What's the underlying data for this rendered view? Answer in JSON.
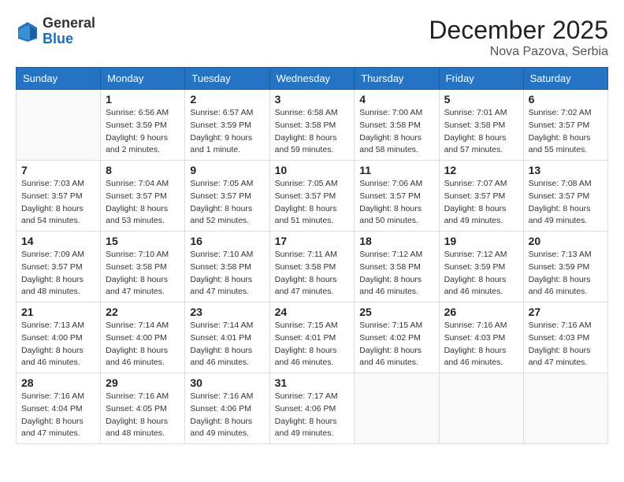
{
  "logo": {
    "general": "General",
    "blue": "Blue"
  },
  "header": {
    "month": "December 2025",
    "location": "Nova Pazova, Serbia"
  },
  "weekdays": [
    "Sunday",
    "Monday",
    "Tuesday",
    "Wednesday",
    "Thursday",
    "Friday",
    "Saturday"
  ],
  "weeks": [
    [
      {
        "day": "",
        "info": ""
      },
      {
        "day": "1",
        "info": "Sunrise: 6:56 AM\nSunset: 3:59 PM\nDaylight: 9 hours\nand 2 minutes."
      },
      {
        "day": "2",
        "info": "Sunrise: 6:57 AM\nSunset: 3:59 PM\nDaylight: 9 hours\nand 1 minute."
      },
      {
        "day": "3",
        "info": "Sunrise: 6:58 AM\nSunset: 3:58 PM\nDaylight: 8 hours\nand 59 minutes."
      },
      {
        "day": "4",
        "info": "Sunrise: 7:00 AM\nSunset: 3:58 PM\nDaylight: 8 hours\nand 58 minutes."
      },
      {
        "day": "5",
        "info": "Sunrise: 7:01 AM\nSunset: 3:58 PM\nDaylight: 8 hours\nand 57 minutes."
      },
      {
        "day": "6",
        "info": "Sunrise: 7:02 AM\nSunset: 3:57 PM\nDaylight: 8 hours\nand 55 minutes."
      }
    ],
    [
      {
        "day": "7",
        "info": "Sunrise: 7:03 AM\nSunset: 3:57 PM\nDaylight: 8 hours\nand 54 minutes."
      },
      {
        "day": "8",
        "info": "Sunrise: 7:04 AM\nSunset: 3:57 PM\nDaylight: 8 hours\nand 53 minutes."
      },
      {
        "day": "9",
        "info": "Sunrise: 7:05 AM\nSunset: 3:57 PM\nDaylight: 8 hours\nand 52 minutes."
      },
      {
        "day": "10",
        "info": "Sunrise: 7:05 AM\nSunset: 3:57 PM\nDaylight: 8 hours\nand 51 minutes."
      },
      {
        "day": "11",
        "info": "Sunrise: 7:06 AM\nSunset: 3:57 PM\nDaylight: 8 hours\nand 50 minutes."
      },
      {
        "day": "12",
        "info": "Sunrise: 7:07 AM\nSunset: 3:57 PM\nDaylight: 8 hours\nand 49 minutes."
      },
      {
        "day": "13",
        "info": "Sunrise: 7:08 AM\nSunset: 3:57 PM\nDaylight: 8 hours\nand 49 minutes."
      }
    ],
    [
      {
        "day": "14",
        "info": "Sunrise: 7:09 AM\nSunset: 3:57 PM\nDaylight: 8 hours\nand 48 minutes."
      },
      {
        "day": "15",
        "info": "Sunrise: 7:10 AM\nSunset: 3:58 PM\nDaylight: 8 hours\nand 47 minutes."
      },
      {
        "day": "16",
        "info": "Sunrise: 7:10 AM\nSunset: 3:58 PM\nDaylight: 8 hours\nand 47 minutes."
      },
      {
        "day": "17",
        "info": "Sunrise: 7:11 AM\nSunset: 3:58 PM\nDaylight: 8 hours\nand 47 minutes."
      },
      {
        "day": "18",
        "info": "Sunrise: 7:12 AM\nSunset: 3:58 PM\nDaylight: 8 hours\nand 46 minutes."
      },
      {
        "day": "19",
        "info": "Sunrise: 7:12 AM\nSunset: 3:59 PM\nDaylight: 8 hours\nand 46 minutes."
      },
      {
        "day": "20",
        "info": "Sunrise: 7:13 AM\nSunset: 3:59 PM\nDaylight: 8 hours\nand 46 minutes."
      }
    ],
    [
      {
        "day": "21",
        "info": "Sunrise: 7:13 AM\nSunset: 4:00 PM\nDaylight: 8 hours\nand 46 minutes."
      },
      {
        "day": "22",
        "info": "Sunrise: 7:14 AM\nSunset: 4:00 PM\nDaylight: 8 hours\nand 46 minutes."
      },
      {
        "day": "23",
        "info": "Sunrise: 7:14 AM\nSunset: 4:01 PM\nDaylight: 8 hours\nand 46 minutes."
      },
      {
        "day": "24",
        "info": "Sunrise: 7:15 AM\nSunset: 4:01 PM\nDaylight: 8 hours\nand 46 minutes."
      },
      {
        "day": "25",
        "info": "Sunrise: 7:15 AM\nSunset: 4:02 PM\nDaylight: 8 hours\nand 46 minutes."
      },
      {
        "day": "26",
        "info": "Sunrise: 7:16 AM\nSunset: 4:03 PM\nDaylight: 8 hours\nand 46 minutes."
      },
      {
        "day": "27",
        "info": "Sunrise: 7:16 AM\nSunset: 4:03 PM\nDaylight: 8 hours\nand 47 minutes."
      }
    ],
    [
      {
        "day": "28",
        "info": "Sunrise: 7:16 AM\nSunset: 4:04 PM\nDaylight: 8 hours\nand 47 minutes."
      },
      {
        "day": "29",
        "info": "Sunrise: 7:16 AM\nSunset: 4:05 PM\nDaylight: 8 hours\nand 48 minutes."
      },
      {
        "day": "30",
        "info": "Sunrise: 7:16 AM\nSunset: 4:06 PM\nDaylight: 8 hours\nand 49 minutes."
      },
      {
        "day": "31",
        "info": "Sunrise: 7:17 AM\nSunset: 4:06 PM\nDaylight: 8 hours\nand 49 minutes."
      },
      {
        "day": "",
        "info": ""
      },
      {
        "day": "",
        "info": ""
      },
      {
        "day": "",
        "info": ""
      }
    ]
  ]
}
